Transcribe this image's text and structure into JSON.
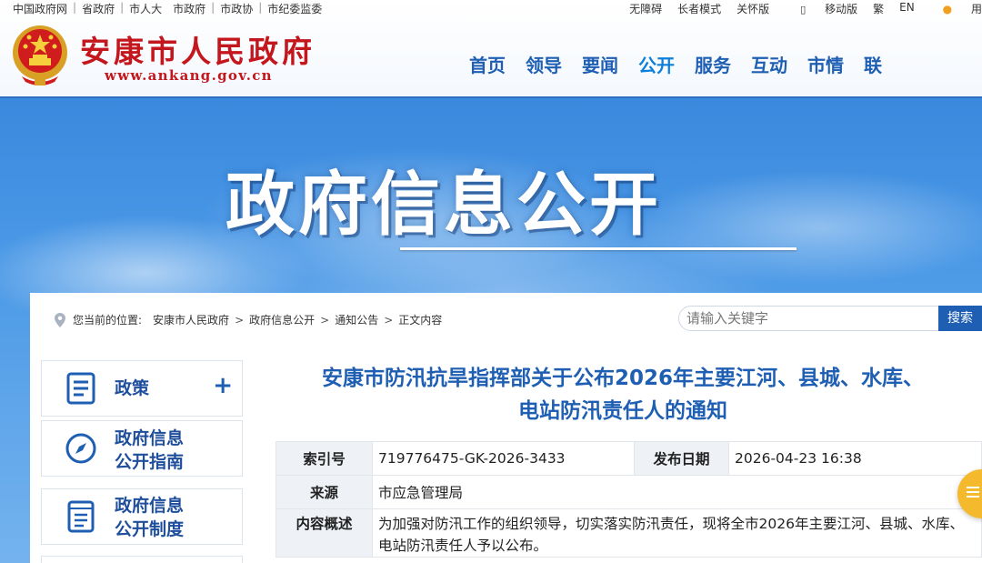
{
  "topbar": {
    "left_links": [
      "中国政府网",
      "省政府",
      "市人大",
      "市政府",
      "市政协",
      "市纪委监委"
    ],
    "right_links": [
      "无障碍",
      "长者模式",
      "关怀版",
      "移动版",
      "繁",
      "EN",
      "用"
    ]
  },
  "header": {
    "site_name": "安康市人民政府",
    "site_url": "www.ankang.gov.cn",
    "nav": [
      "首页",
      "领导",
      "要闻",
      "公开",
      "服务",
      "互动",
      "市情",
      "联"
    ],
    "active_nav": "公开",
    "brand_color": "#c4171d",
    "nav_color": "#1f5fb3"
  },
  "hero": {
    "title": "政府信息公开"
  },
  "breadcrumb": {
    "prefix": "您当前的位置:",
    "items": [
      "安康市人民政府",
      "政府信息公开",
      "通知公告",
      "正文内容"
    ],
    "separator": ">"
  },
  "search": {
    "placeholder": "请输入关键字",
    "button": "搜索"
  },
  "sidebar": {
    "items": [
      {
        "label": "政策",
        "icon": "document-icon",
        "expandable": true,
        "expand_symbol": "+"
      },
      {
        "label_line1": "政府信息",
        "label_line2": "公开指南",
        "icon": "compass-icon"
      },
      {
        "label_line1": "政府信息",
        "label_line2": "公开制度",
        "icon": "list-doc-icon"
      }
    ]
  },
  "article": {
    "title_line1": "安康市防汛抗旱指挥部关于公布2026年主要江河、县城、水库、",
    "title_line2": "电站防汛责任人的通知",
    "meta": {
      "index_label": "索引号",
      "index_value": "719776475-GK-2026-3433",
      "date_label": "发布日期",
      "date_value": "2026-04-23 16:38",
      "source_label": "来源",
      "source_value": "市应急管理局",
      "summary_label": "内容概述",
      "summary_value": "为加强对防汛工作的组织领导，切实落实防汛责任，现将全市2026年主要江河、县城、水库、电站防汛责任人予以公布。"
    }
  },
  "floating": {
    "icon": "menu-lines-icon",
    "color": "#f4b92c"
  }
}
